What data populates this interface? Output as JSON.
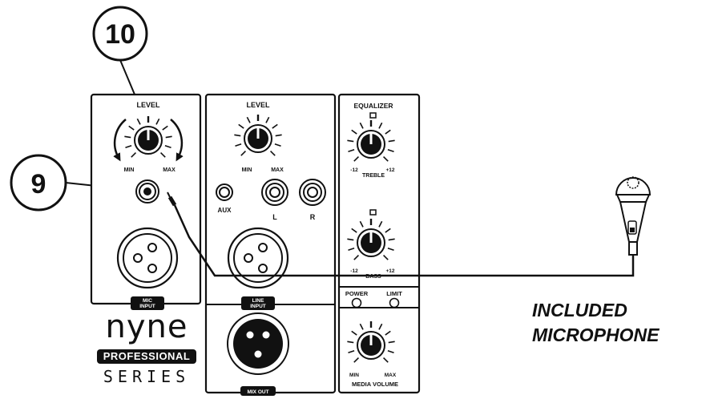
{
  "callouts": {
    "level_knob_number": "10",
    "mic_jack_number": "9"
  },
  "mic_section": {
    "level_label": "LEVEL",
    "min_label": "MIN",
    "max_label": "MAX",
    "input_label": "MIC\nINPUT"
  },
  "line_section": {
    "level_label": "LEVEL",
    "min_label": "MIN",
    "max_label": "MAX",
    "aux_label": "AUX",
    "left_label": "L",
    "right_label": "R",
    "input_label": "LINE\nINPUT",
    "mix_out_label": "MIX OUT"
  },
  "eq_section": {
    "title": "EQUALIZER",
    "treble_min": "-12",
    "treble_max": "+12",
    "treble_label": "TREBLE",
    "bass_min": "-12",
    "bass_max": "+12",
    "bass_label": "BASS"
  },
  "indicators": {
    "power_label": "POWER",
    "limit_label": "LIMIT"
  },
  "media_section": {
    "min_label": "MIN",
    "max_label": "MAX",
    "label": "MEDIA VOLUME"
  },
  "brand": {
    "logo": "nyne",
    "tagline": "PROFESSIONAL",
    "series": "SERIES"
  },
  "microphone_caption": {
    "line1": "INCLUDED",
    "line2": "MICROPHONE"
  }
}
